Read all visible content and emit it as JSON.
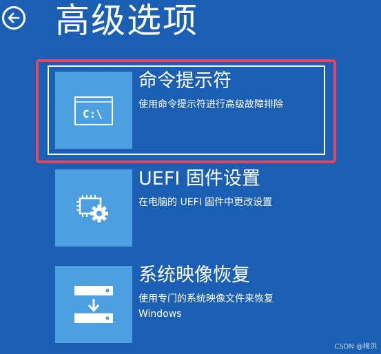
{
  "page": {
    "title": "高级选项"
  },
  "options": [
    {
      "title": "命令提示符",
      "description_lines": [
        "使用命令提示符进行高级故障排除"
      ],
      "icon": "command-prompt-icon",
      "tile_text": "C:\\"
    },
    {
      "title": "UEFI 固件设置",
      "description_lines": [
        "在电脑的 UEFI 固件中更改设置"
      ],
      "icon": "firmware-settings-icon"
    },
    {
      "title": "系统映像恢复",
      "description_lines": [
        "使用专门的系统映像文件来恢复",
        "Windows"
      ],
      "icon": "system-image-restore-icon"
    }
  ],
  "watermark": "CSDN @梅洪",
  "colors": {
    "background": "#1a5fb4",
    "tile": "#4c9fe1",
    "highlight": "#e5455f",
    "text": "#ffffff"
  }
}
